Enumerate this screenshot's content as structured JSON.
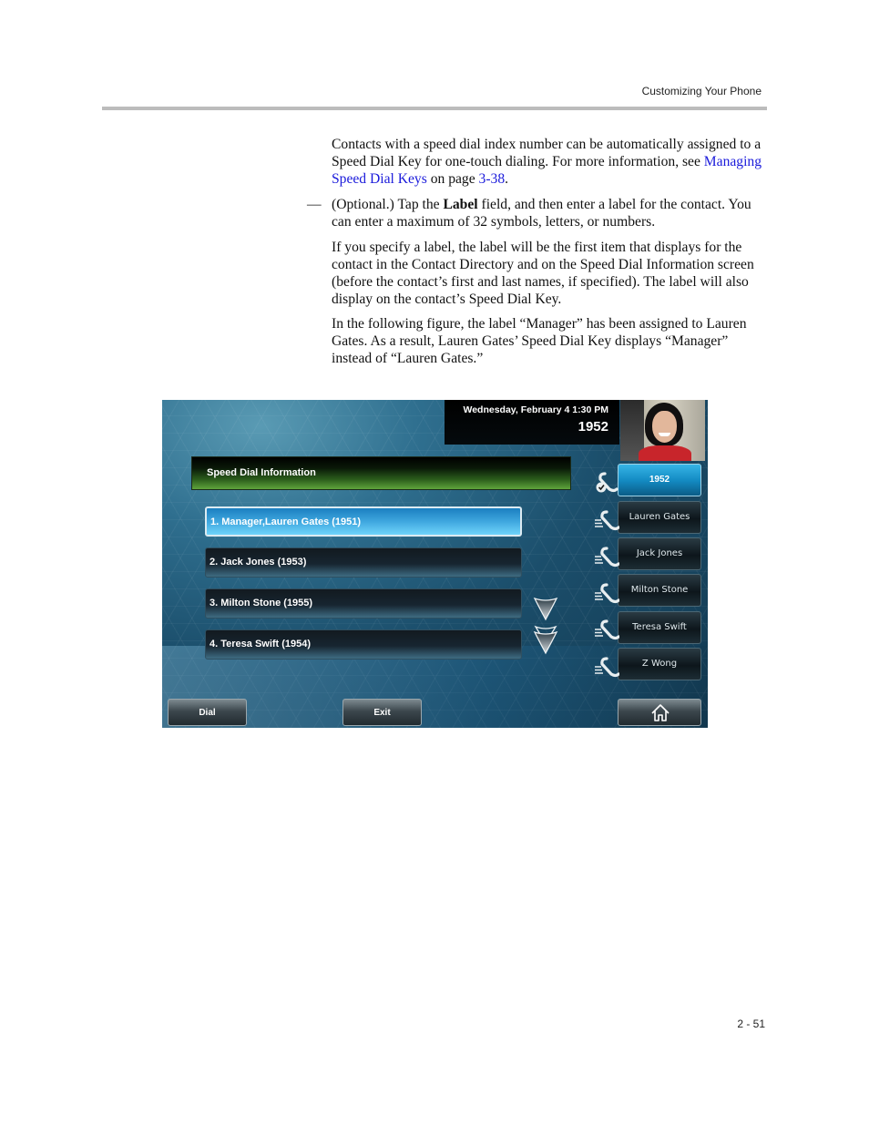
{
  "running_head": "Customizing Your Phone",
  "page_number": "2 - 51",
  "paragraphs": {
    "p1_before_link": "Contacts with a speed dial index number can be automatically assigned to a Speed Dial Key for one-touch dialing. For more information, see ",
    "p1_link": "Managing Speed Dial Keys",
    "p1_middle": " on page ",
    "p1_page_link": "3-38",
    "p1_end": ".",
    "p2_dash": "—",
    "p2_before_bold": "(Optional.) Tap the ",
    "p2_bold": "Label",
    "p2_after_bold": " field, and then enter a label for the contact. You can enter a maximum of 32 symbols, letters, or numbers.",
    "p3": "If you specify a label, the label will be the first item that displays for the contact in the Contact Directory and on the Speed Dial Information screen (before the contact’s first and last names, if specified). The label will also display on the contact’s Speed Dial Key.",
    "p4": "In the following figure, the label “Manager” has been assigned to Lauren Gates. As a result, Lauren Gates’ Speed Dial Key displays “Manager” instead of “Lauren Gates.”"
  },
  "phone_screen": {
    "datetime": "Wednesday, February 4  1:30 PM",
    "line_number": "1952",
    "header_title": "Speed Dial Information",
    "list_items": [
      {
        "label": "1. Manager,Lauren Gates (1951)",
        "selected": true
      },
      {
        "label": "2. Jack Jones (1953)",
        "selected": false
      },
      {
        "label": "3. Milton Stone (1955)",
        "selected": false
      },
      {
        "label": "4. Teresa Swift (1954)",
        "selected": false
      }
    ],
    "line_keys": [
      {
        "label": "1952",
        "icon": "handset-registered-icon",
        "active": true
      },
      {
        "label": "Lauren Gates",
        "icon": "speed-dial-handset-icon",
        "active": false
      },
      {
        "label": "Jack Jones",
        "icon": "speed-dial-handset-icon",
        "active": false
      },
      {
        "label": "Milton Stone",
        "icon": "speed-dial-handset-icon",
        "active": false
      },
      {
        "label": "Teresa Swift",
        "icon": "speed-dial-handset-icon",
        "active": false
      },
      {
        "label": "Z Wong",
        "icon": "speed-dial-handset-icon",
        "active": false
      }
    ],
    "scroll_buttons": [
      "scroll-down-icon",
      "page-down-icon"
    ],
    "soft_keys": {
      "dial": "Dial",
      "exit": "Exit",
      "home_icon": "home-icon"
    },
    "colors": {
      "selected_item": "#3fa7df",
      "header_green": "#5fa43c",
      "active_line_key": "#148cc4",
      "link": "#1a1adb"
    }
  }
}
